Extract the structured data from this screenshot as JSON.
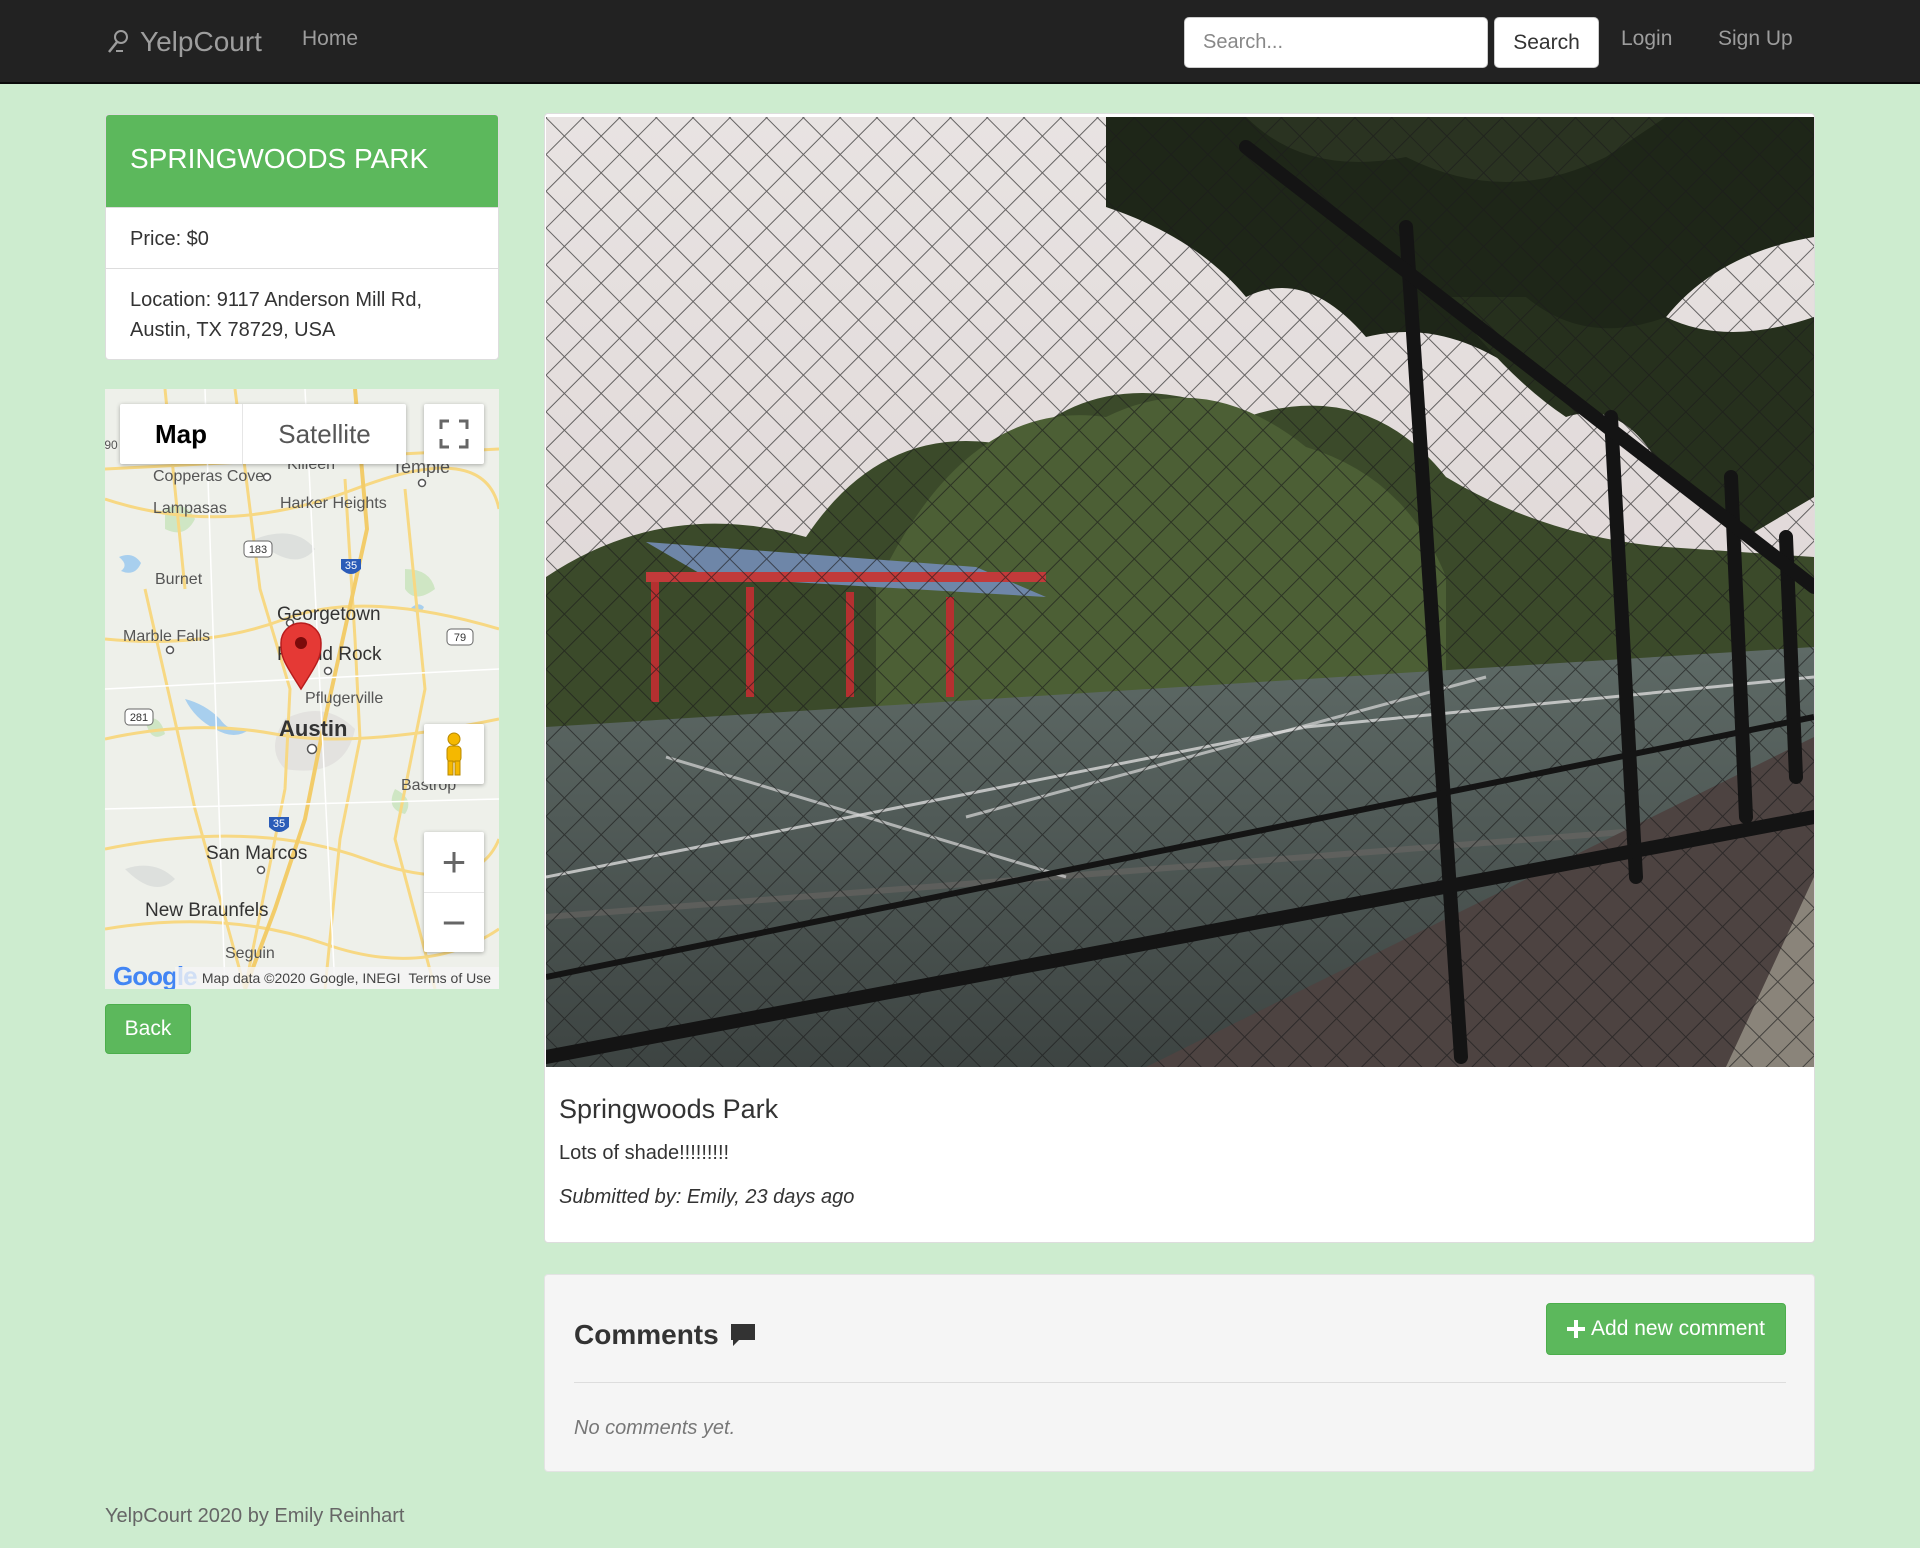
{
  "navbar": {
    "brand": "YelpCourt",
    "home": "Home",
    "search_placeholder": "Search...",
    "search_button": "Search",
    "login": "Login",
    "signup": "Sign Up"
  },
  "court": {
    "title": "SPRINGWOODS PARK",
    "price": "Price: $0",
    "location_line1": "Location: 9117 Anderson Mill Rd,",
    "location_line2": "Austin, TX 78729, USA"
  },
  "map": {
    "tab_map": "Map",
    "tab_satellite": "Satellite",
    "attribution": "Map data ©2020 Google, INEGI",
    "terms": "Terms of Use",
    "logo": "Google",
    "places": {
      "killeen": "Killeen",
      "temple": "Temple",
      "copperas_cove": "Copperas Cove",
      "harker_heights": "Harker Heights",
      "lampasas": "Lampasas",
      "burnet": "Burnet",
      "georgetown": "Georgetown",
      "marble_falls": "Marble Falls",
      "round_rock": "Round Rock",
      "pflugerville": "Pflugerville",
      "austin": "Austin",
      "bastrop": "Bastrop",
      "san_marcos": "San Marcos",
      "new_braunfels": "New Braunfels",
      "seguin": "Seguin"
    },
    "shields": {
      "us183": "183",
      "i35a": "35",
      "tx79": "79",
      "us281": "281",
      "i35b": "35",
      "x90": "90"
    },
    "icons": [
      "fullscreen-icon",
      "pegman-icon",
      "zoom-in-icon",
      "zoom-out-icon",
      "map-pin-icon"
    ]
  },
  "back_button": "Back",
  "post": {
    "title": "Springwoods Park",
    "description": "Lots of shade!!!!!!!!!",
    "submitted_by": "Submitted by: Emily, 23 days ago"
  },
  "comments": {
    "title": "Comments",
    "add_button": "Add new comment",
    "empty": "No comments yet."
  },
  "footer": "YelpCourt 2020 by Emily Reinhart",
  "colors": {
    "navbar_bg": "#222222",
    "page_bg": "#cdeccf",
    "accent_green": "#5cb85c",
    "muted_text": "#9d9d9d"
  }
}
